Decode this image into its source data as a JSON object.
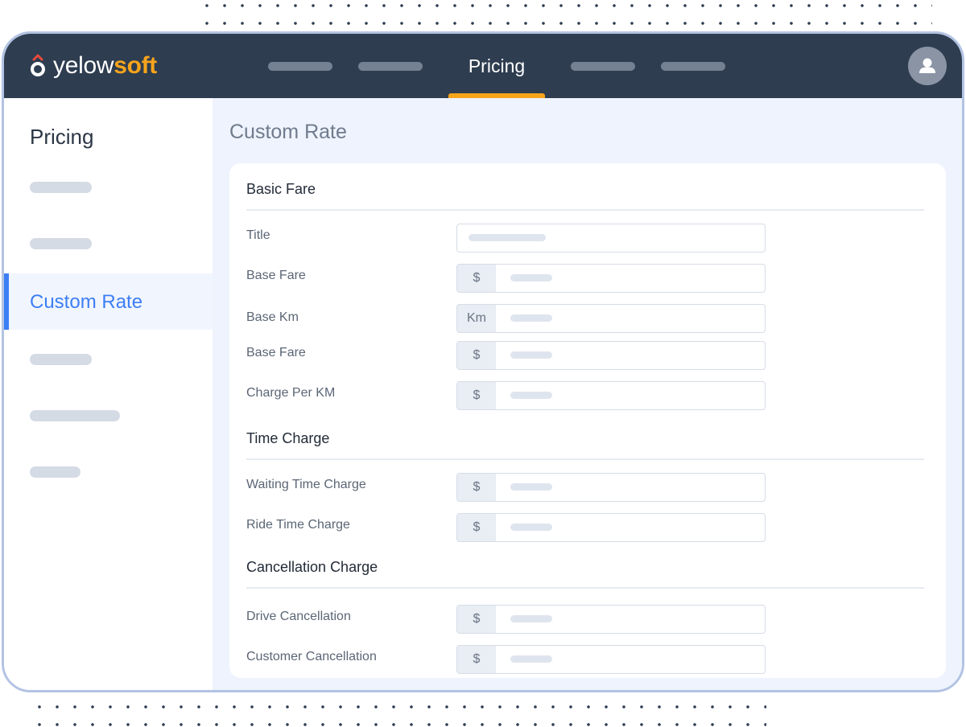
{
  "brand": {
    "name_part1": "yelow",
    "name_part2": "soft",
    "accent_color": "#f7a41c",
    "mark_icon": "yelowsoft-logo-mark"
  },
  "topnav": {
    "active_label": "Pricing",
    "placeholder_items": 4
  },
  "user": {
    "avatar_icon": "user-icon"
  },
  "sidebar": {
    "title": "Pricing",
    "active_label": "Custom Rate",
    "active_color": "#3d7ef5"
  },
  "main": {
    "title": "Custom Rate",
    "sections": [
      {
        "title": "Basic Fare",
        "fields": [
          {
            "label": "Title",
            "prefix": ""
          },
          {
            "label": "Base Fare",
            "prefix": "$"
          },
          {
            "label": "Base Km",
            "prefix": "Km"
          },
          {
            "label": "Base Fare",
            "prefix": "$"
          },
          {
            "label": "Charge Per KM",
            "prefix": "$"
          }
        ]
      },
      {
        "title": "Time Charge",
        "fields": [
          {
            "label": "Waiting Time Charge",
            "prefix": "$"
          },
          {
            "label": "Ride Time Charge",
            "prefix": "$"
          }
        ]
      },
      {
        "title": "Cancellation Charge",
        "fields": [
          {
            "label": "Drive Cancellation",
            "prefix": "$"
          },
          {
            "label": "Customer Cancellation",
            "prefix": "$"
          }
        ]
      }
    ]
  }
}
